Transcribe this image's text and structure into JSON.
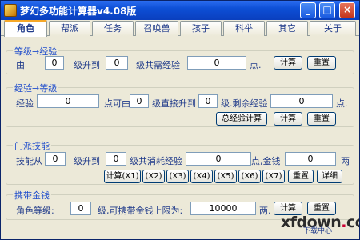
{
  "window": {
    "title": "梦幻多功能计算器v4.08版",
    "minimize": "_",
    "maximize": "□",
    "close": "×"
  },
  "tabs": [
    "角色",
    "帮派",
    "任务",
    "召唤兽",
    "孩子",
    "科举",
    "其它",
    "关于"
  ],
  "level_exp": {
    "legend": "等级→经验",
    "from_label": "由",
    "from_value": "0",
    "to_label": "级升到",
    "to_value": "0",
    "need_label": "级共需经验",
    "need_value": "0",
    "point": "点.",
    "calc": "计算",
    "reset": "重置"
  },
  "exp_level": {
    "legend": "经验→等级",
    "exp_label": "经验",
    "exp_value": "0",
    "from_label": "点可由",
    "from_value": "0",
    "to_label": "级直接升到",
    "to_value": "0",
    "remain_label": "级.剩余经验",
    "remain_value": "0",
    "point": "点.",
    "total_btn": "总经验计算",
    "calc": "计算",
    "reset": "重置"
  },
  "skill": {
    "legend": "门派技能",
    "from_label": "技能从",
    "from_value": "0",
    "to_label": "级升到",
    "to_value": "0",
    "exp_label": "级共消耗经验",
    "exp_value": "0",
    "money_label": "点,金钱",
    "money_value": "0",
    "unit": "两",
    "buttons": [
      "计算(X1)",
      "(X2)",
      "(X3)",
      "(X4)",
      "(X5)",
      "(X6)",
      "(X7)"
    ],
    "reset": "重置",
    "detail": "详细"
  },
  "money": {
    "legend": "携带金钱",
    "role_label": "角色等级:",
    "role_value": "0",
    "limit_label": "级,可携带金钱上限为:",
    "limit_value": "10000",
    "unit": "两.",
    "calc": "计算",
    "reset": "重置"
  },
  "watermark": {
    "main": "xfdown",
    "dot": ".",
    "tail": "com",
    "sub": "下载中心"
  }
}
